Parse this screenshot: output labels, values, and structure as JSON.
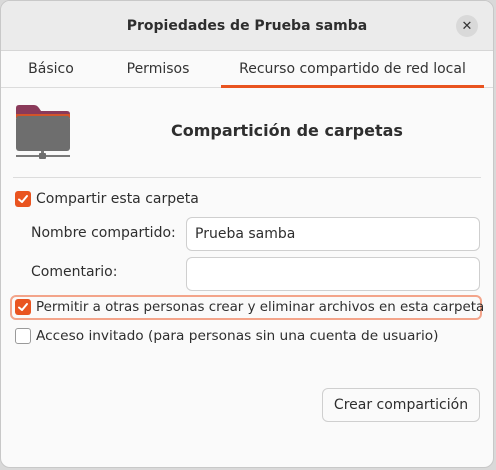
{
  "window": {
    "title": "Propiedades de Prueba samba",
    "close_glyph": "✕"
  },
  "tabs": [
    {
      "label": "Básico",
      "active": false
    },
    {
      "label": "Permisos",
      "active": false
    },
    {
      "label": "Recurso compartido de red local",
      "active": true
    }
  ],
  "share": {
    "heading": "Compartición de carpetas",
    "icon": "folder-network-icon",
    "share_folder": {
      "label": "Compartir esta carpeta",
      "checked": true
    },
    "share_name": {
      "label": "Nombre compartido:",
      "value": "Prueba samba"
    },
    "comment": {
      "label": "Comentario:",
      "value": ""
    },
    "allow_others": {
      "label": "Permitir a otras personas crear y eliminar archivos en esta carpeta",
      "checked": true
    },
    "guest_access": {
      "label": "Acceso invitado (para personas sin una cuenta de usuario)",
      "checked": false
    },
    "create_button": "Crear compartición"
  },
  "colors": {
    "accent": "#e95420",
    "folder_top": "#8a3a5a",
    "folder_body": "#6e6e6e"
  }
}
